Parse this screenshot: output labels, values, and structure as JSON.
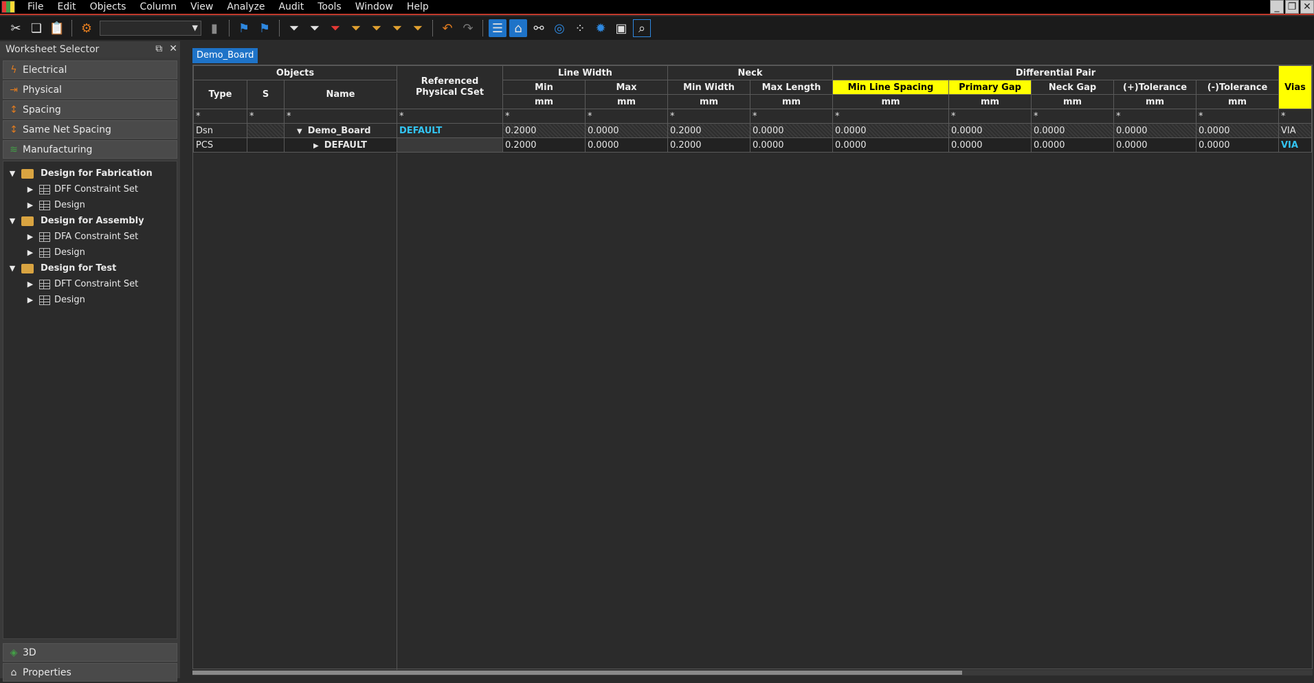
{
  "menu": [
    "File",
    "Edit",
    "Objects",
    "Column",
    "View",
    "Analyze",
    "Audit",
    "Tools",
    "Window",
    "Help"
  ],
  "window_controls": [
    "minimize",
    "restore",
    "close"
  ],
  "toolbar": {
    "combo_value": "",
    "icons": [
      "scissors-icon",
      "copy-icon",
      "paste-icon",
      "find-icon",
      "bookmark-icon",
      "bookmark-next-icon",
      "bookmark-prev-icon",
      "filter-icon",
      "filter-icon",
      "filter-error-icon",
      "filter-icon",
      "filter-icon",
      "filter-icon",
      "filter-icon",
      "undo-icon",
      "redo-icon",
      "worksheet-icon",
      "tag-icon",
      "net-icon",
      "target-icon",
      "dots-icon",
      "settings-icon",
      "save-icon",
      "search-icon"
    ]
  },
  "left_panel": {
    "title": "Worksheet Selector",
    "worksheets": [
      "Electrical",
      "Physical",
      "Spacing",
      "Same Net Spacing",
      "Manufacturing"
    ],
    "tree": [
      {
        "label": "Design for Fabrication",
        "level": 0,
        "expanded": true,
        "type": "folder"
      },
      {
        "label": "DFF Constraint Set",
        "level": 1,
        "expanded": false,
        "type": "sheet"
      },
      {
        "label": "Design",
        "level": 1,
        "expanded": false,
        "type": "sheet"
      },
      {
        "label": "Design for Assembly",
        "level": 0,
        "expanded": true,
        "type": "folder"
      },
      {
        "label": "DFA Constraint Set",
        "level": 1,
        "expanded": false,
        "type": "sheet"
      },
      {
        "label": "Design",
        "level": 1,
        "expanded": false,
        "type": "sheet"
      },
      {
        "label": "Design for Test",
        "level": 0,
        "expanded": true,
        "type": "folder"
      },
      {
        "label": "DFT Constraint Set",
        "level": 1,
        "expanded": false,
        "type": "sheet"
      },
      {
        "label": "Design",
        "level": 1,
        "expanded": false,
        "type": "sheet"
      }
    ],
    "bottom": [
      "3D",
      "Properties"
    ]
  },
  "doc_tab": "Demo_Board",
  "grid": {
    "group_objects": "Objects",
    "group_ref": "Referenced Physical CSet",
    "group_line_width": "Line Width",
    "group_neck": "Neck",
    "group_diff_pair": "Differential Pair",
    "group_vias": "Vias",
    "col_type": "Type",
    "col_s": "S",
    "col_name": "Name",
    "col_min": "Min",
    "col_max": "Max",
    "col_min_width": "Min Width",
    "col_max_length": "Max Length",
    "col_min_line_spacing": "Min Line Spacing",
    "col_primary_gap": "Primary Gap",
    "col_neck_gap": "Neck Gap",
    "col_plus_tol": "(+)Tolerance",
    "col_minus_tol": "(-)Tolerance",
    "unit": "mm",
    "filter": "*",
    "rows": [
      {
        "type": "Dsn",
        "s": "",
        "expander": "▼",
        "name": "Demo_Board",
        "ref": "DEFAULT",
        "min": "0.2000",
        "max": "0.0000",
        "min_width": "0.2000",
        "max_length": "0.0000",
        "min_line_spacing": "0.0000",
        "primary_gap": "0.0000",
        "neck_gap": "0.0000",
        "plus_tol": "0.0000",
        "minus_tol": "0.0000",
        "vias": "VIA"
      },
      {
        "type": "PCS",
        "s": "",
        "expander": "▶",
        "name": "DEFAULT",
        "ref": "",
        "min": "0.2000",
        "max": "0.0000",
        "min_width": "0.2000",
        "max_length": "0.0000",
        "min_line_spacing": "0.0000",
        "primary_gap": "0.0000",
        "neck_gap": "0.0000",
        "plus_tol": "0.0000",
        "minus_tol": "0.0000",
        "vias": "VIA"
      }
    ]
  },
  "colors": {
    "highlight_yellow": "#ffff00",
    "accent_blue": "#1e73c8",
    "link_cyan": "#33c4f2",
    "menu_border_red": "#c0392b"
  }
}
